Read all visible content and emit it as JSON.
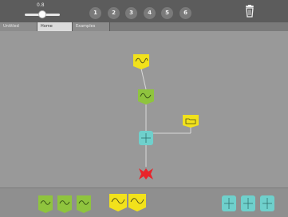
{
  "toolbar": {
    "slider_value": "0.8",
    "slider_level": 0.5,
    "buttons": [
      "1",
      "2",
      "3",
      "4",
      "5",
      "6"
    ]
  },
  "tabs": [
    {
      "label": "Untitled",
      "active": false
    },
    {
      "label": "Home",
      "active": true
    },
    {
      "label": "Examples",
      "active": false
    }
  ],
  "colors": {
    "topbar": "#5c5c5c",
    "canvas": "#999999",
    "tray": "#8f8f8f",
    "yellow_node": "#f2e21b",
    "green_node": "#8fc43e",
    "teal_node": "#6fd0cc",
    "red_node": "#e8242b",
    "connector": "#d9d9d9"
  },
  "icons": {
    "delete": "trash-icon",
    "node_yellow": "squiggle-icon",
    "node_folder": "folder-icon",
    "node_green": "squiggle-icon",
    "node_teal": "grid-icon",
    "node_red": "x-icon"
  }
}
